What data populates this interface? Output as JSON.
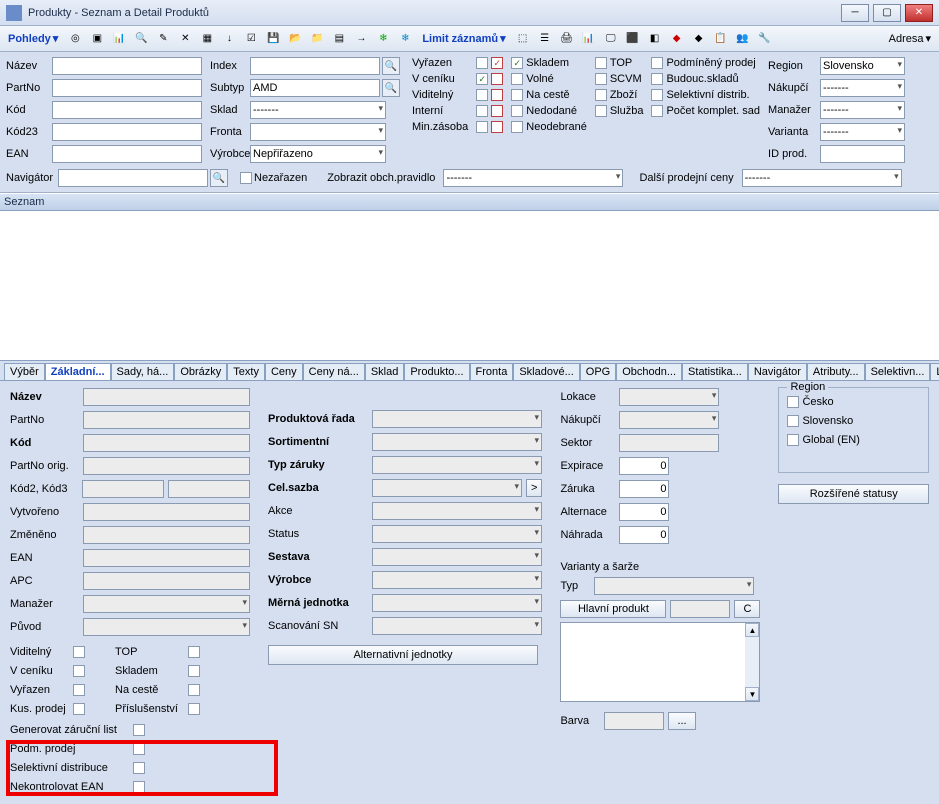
{
  "window": {
    "title": "Produkty - Seznam a Detail Produktů"
  },
  "menu": {
    "pohledy": "Pohledy",
    "limit": "Limit záznamů",
    "adresa": "Adresa"
  },
  "filter": {
    "labels": {
      "nazev": "Název",
      "partno": "PartNo",
      "kod": "Kód",
      "kod23": "Kód23",
      "ean": "EAN",
      "index": "Index",
      "subtyp": "Subtyp",
      "sklad": "Sklad",
      "fronta": "Fronta",
      "vyrobce": "Výrobce",
      "navigator": "Navigátor",
      "nezarazen": "Nezařazen",
      "zobrazit": "Zobrazit obch.pravidlo",
      "dalsi": "Další prodejní ceny",
      "region": "Region",
      "nakupci": "Nákupčí",
      "manazer": "Manažer",
      "varianta": "Varianta",
      "idprod": "ID prod."
    },
    "values": {
      "subtyp": "AMD",
      "sklad": "-------",
      "vyrobce": "Nepřiřazeno",
      "zobrazit_val": "-------",
      "dalsi_val": "-------",
      "region_val": "Slovensko",
      "nakupci_val": "-------",
      "manazer_val": "-------",
      "varianta_val": "-------"
    },
    "chk_left": [
      {
        "l": "Vyřazen"
      },
      {
        "l": "V ceníku"
      },
      {
        "l": "Viditelný"
      },
      {
        "l": "Interní"
      },
      {
        "l": "Min.zásoba"
      }
    ],
    "chk_mid": [
      {
        "l": "Skladem"
      },
      {
        "l": "Volné"
      },
      {
        "l": "Na cestě"
      },
      {
        "l": "Nedodané"
      },
      {
        "l": "Neodebrané"
      }
    ],
    "chk_r1": [
      {
        "l": "TOP"
      },
      {
        "l": "SCVM"
      },
      {
        "l": "Zboží"
      },
      {
        "l": "Služba"
      }
    ],
    "chk_r2": [
      {
        "l": "Podmíněný prodej"
      },
      {
        "l": "Budouc.skladů"
      },
      {
        "l": "Selektivní distrib."
      },
      {
        "l": "Počet komplet. sad"
      }
    ]
  },
  "seznam": "Seznam",
  "tabs": [
    "Výběr",
    "Základní...",
    "Sady, há...",
    "Obrázky",
    "Texty",
    "Ceny",
    "Ceny ná...",
    "Sklad",
    "Produkto...",
    "Fronta",
    "Skladové...",
    "OPG",
    "Obchodn...",
    "Statistika...",
    "Navigátor",
    "Atributy...",
    "Selektivn...",
    "Licence"
  ],
  "detail": {
    "col1": {
      "nazev": "Název",
      "partno": "PartNo",
      "kod": "Kód",
      "partno_orig": "PartNo orig.",
      "kod2": "Kód2, Kód3",
      "vytvoreno": "Vytvořeno",
      "zmeneno": "Změněno",
      "ean": "EAN",
      "apc": "APC",
      "manazer": "Manažer",
      "puvod": "Původ"
    },
    "col1_chks": [
      {
        "l": "Viditelný"
      },
      {
        "l": "V ceníku"
      },
      {
        "l": "Vyřazen"
      },
      {
        "l": "Kus. prodej"
      }
    ],
    "col1_chks_b": [
      {
        "l": "TOP"
      },
      {
        "l": "Skladem"
      },
      {
        "l": "Na cestě"
      },
      {
        "l": "Příslušenství"
      }
    ],
    "col1_chks_full": [
      {
        "l": "Generovat záruční list"
      },
      {
        "l": "Podm. prodej"
      },
      {
        "l": "Selektivní distribuce"
      },
      {
        "l": "Nekontrolovat EAN"
      }
    ],
    "col2": {
      "prod_rada": "Produktová řada",
      "sortimentni": "Sortimentní",
      "typ_zaruky": "Typ záruky",
      "cel_sazba": "Cel.sazba",
      "akce": "Akce",
      "status": "Status",
      "sestava": "Sestava",
      "vyrobce": "Výrobce",
      "merna": "Měrná jednotka",
      "scan": "Scanování SN",
      "alt_units": "Alternativní jednotky"
    },
    "col3": {
      "lokace": "Lokace",
      "nakupci": "Nákupčí",
      "sektor": "Sektor",
      "expirace": "Expirace",
      "zaruka": "Záruka",
      "alternace": "Alternace",
      "nahrada": "Náhrada",
      "varianty": "Varianty a šarže",
      "typ": "Typ",
      "hlavni": "Hlavní produkt",
      "c": "C",
      "barva": "Barva",
      "dots": "...",
      "vals": {
        "expirace": "0",
        "zaruka": "0",
        "alternace": "0",
        "nahrada": "0"
      }
    },
    "col4": {
      "region": "Region",
      "regions": [
        "Česko",
        "Slovensko",
        "Global (EN)"
      ],
      "rozsirene": "Rozšířené statusy"
    }
  }
}
